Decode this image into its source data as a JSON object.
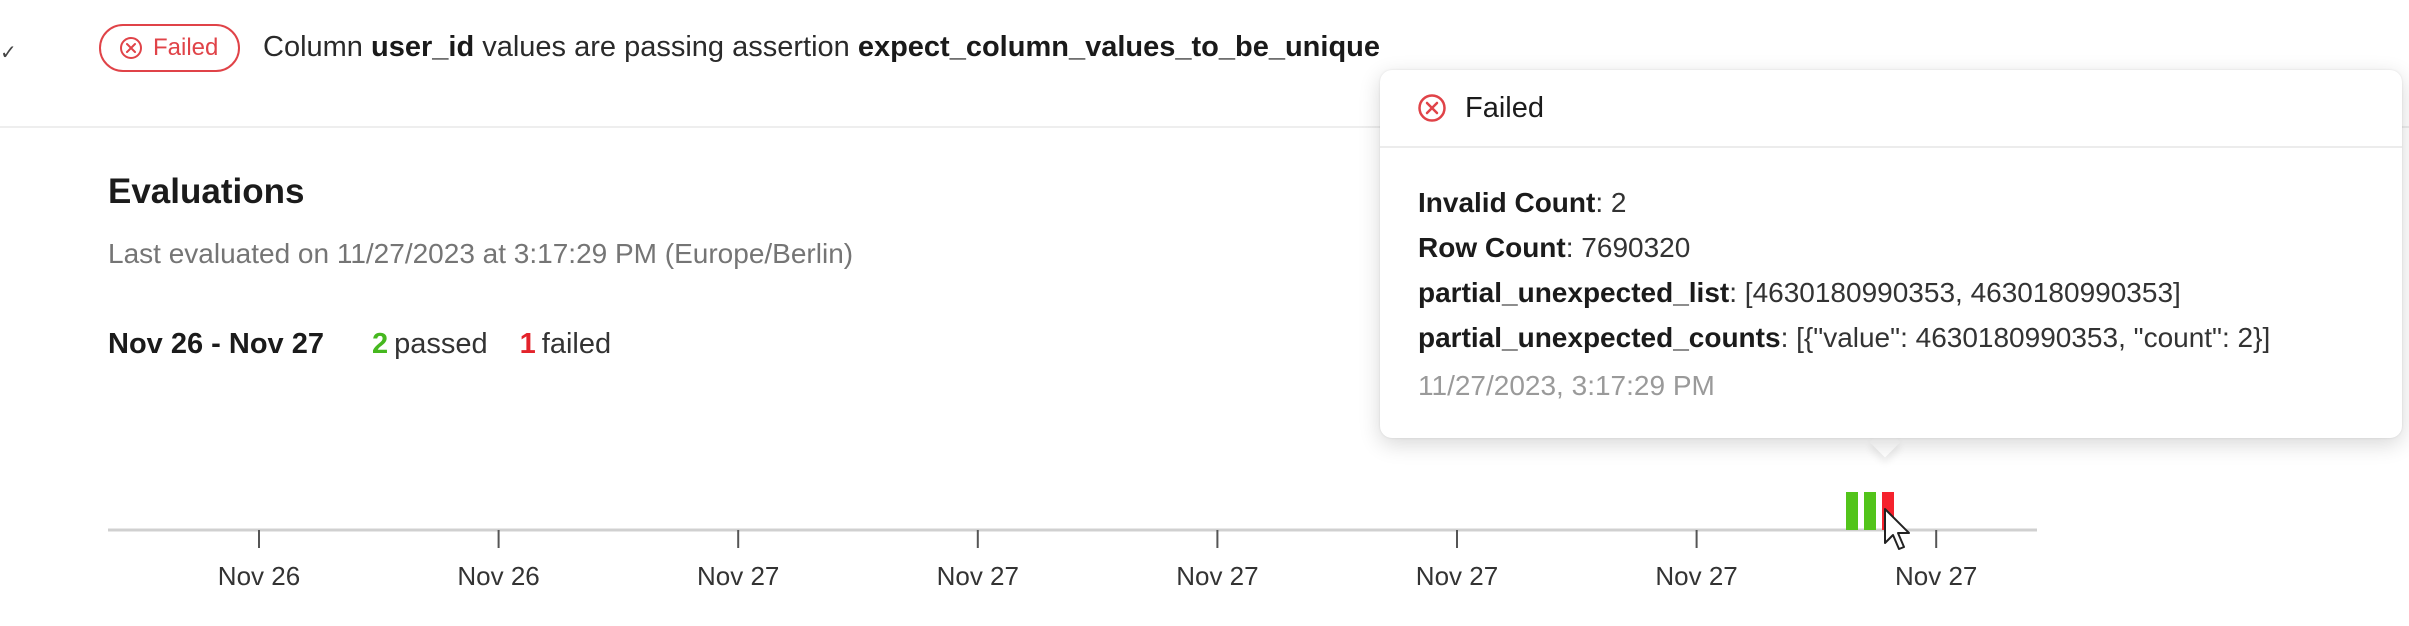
{
  "header": {
    "chevron": "✓",
    "status_badge": "Failed",
    "summary": {
      "prefix": "Column ",
      "column": "user_id",
      "middle": " values are passing assertion ",
      "assertion": "expect_column_values_to_be_unique"
    }
  },
  "evaluations": {
    "title": "Evaluations",
    "last_evaluated": "Last evaluated on 11/27/2023 at 3:17:29 PM (Europe/Berlin)",
    "range": "Nov 26 - Nov 27",
    "passed_count": "2",
    "passed_label": "passed",
    "failed_count": "1",
    "failed_label": "failed"
  },
  "chart_data": {
    "type": "bar",
    "x_tick_labels": [
      "Nov 26",
      "Nov 26",
      "Nov 27",
      "Nov 27",
      "Nov 27",
      "Nov 27",
      "Nov 27",
      "Nov 27"
    ],
    "bars": [
      {
        "result": "passed",
        "value": 1
      },
      {
        "result": "passed",
        "value": 1
      },
      {
        "result": "failed",
        "value": 1
      }
    ],
    "colors": {
      "passed": "#52c41a",
      "failed": "#f5222d"
    },
    "grid": false,
    "legend": "none"
  },
  "tooltip": {
    "status": "Failed",
    "lines": [
      {
        "key": "Invalid Count",
        "value": ": 2"
      },
      {
        "key": "Row Count",
        "value": ": 7690320"
      },
      {
        "key": "partial_unexpected_list",
        "value": ": [4630180990353, 4630180990353]"
      },
      {
        "key": "partial_unexpected_counts",
        "value": ": [{\"value\": 4630180990353, \"count\": 2}]"
      }
    ],
    "timestamp": "11/27/2023, 3:17:29 PM"
  },
  "colors": {
    "failed": "#e04348",
    "passed": "#46b81f",
    "muted_text": "#757575"
  }
}
